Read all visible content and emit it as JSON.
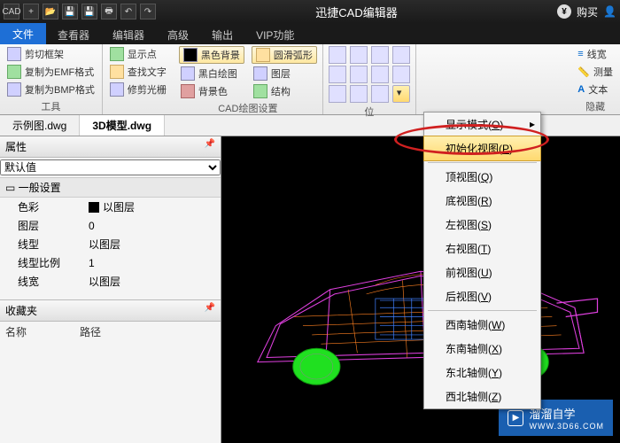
{
  "titlebar": {
    "app_title": "迅捷CAD编辑器",
    "buy": "购买",
    "qat_cad": "CAD"
  },
  "menutabs": {
    "file": "文件",
    "viewer": "查看器",
    "editor": "编辑器",
    "advanced": "高级",
    "output": "输出",
    "vip": "VIP功能"
  },
  "ribbon": {
    "g1": {
      "clip_frame": "剪切框架",
      "copy_emf": "复制为EMF格式",
      "copy_bmp": "复制为BMP格式",
      "label": "工具"
    },
    "g2": {
      "show_points": "显示点",
      "find_text": "查找文字",
      "trim_clip": "修剪光栅"
    },
    "g3": {
      "black_bg": "黑色背景",
      "bw_draw": "黑白绘图",
      "bg_color": "背景色",
      "smooth_arc": "圆滑弧形",
      "layer": "图层",
      "structure": "结构",
      "label": "CAD绘图设置"
    },
    "g4": {
      "label": "位"
    },
    "g5": {
      "linewidth": "线宽",
      "measure": "测量",
      "text": "文本",
      "label": "隐藏"
    }
  },
  "doctabs": {
    "t1": "示例图.dwg",
    "t2": "3D模型.dwg"
  },
  "props": {
    "title": "属性",
    "default": "默认值",
    "general": "一般设置",
    "rows": {
      "color_k": "色彩",
      "color_v": "以图层",
      "layer_k": "图层",
      "layer_v": "0",
      "ltype_k": "线型",
      "ltype_v": "以图层",
      "lscale_k": "线型比例",
      "lscale_v": "1",
      "lwidth_k": "线宽",
      "lwidth_v": "以图层"
    },
    "fav": "收藏夹",
    "favcols": {
      "name": "名称",
      "path": "路径"
    }
  },
  "ctx": {
    "display_mode": "显示模式(O)",
    "init_view": "初始化视图(P)",
    "top": "顶视图(Q)",
    "bottom": "底视图(R)",
    "left": "左视图(S)",
    "right": "右视图(T)",
    "front": "前视图(U)",
    "back": "后视图(V)",
    "sw": "西南轴侧(W)",
    "se": "东南轴侧(X)",
    "ne": "东北轴侧(Y)",
    "nw": "西北轴侧(Z)"
  },
  "watermark": {
    "brand": "溜溜自学",
    "url": "WWW.3D66.COM"
  }
}
